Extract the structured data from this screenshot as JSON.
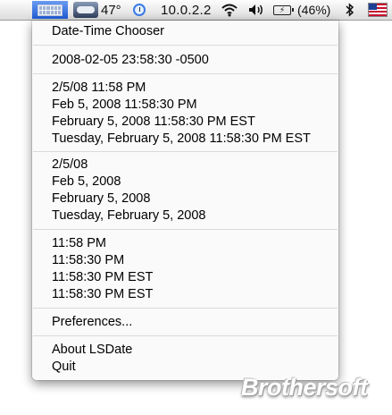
{
  "menubar": {
    "temperature": "47°",
    "ip_address": "10.0.2.2",
    "wifi_icon": "wifi-icon",
    "volume_icon": "volume-icon",
    "battery_icon_glyph": "⚡",
    "battery_percent": "(46%)",
    "bluetooth_icon": "bluetooth-icon",
    "input_flag": "us-flag-icon"
  },
  "menu": {
    "header": "Date-Time Chooser",
    "iso": "2008-02-05 23:58:30 -0500",
    "datetime_formats": [
      "2/5/08 11:58 PM",
      "Feb 5, 2008 11:58:30 PM",
      "February 5, 2008 11:58:30 PM EST",
      "Tuesday, February 5, 2008 11:58:30 PM EST"
    ],
    "date_formats": [
      "2/5/08",
      "Feb 5, 2008",
      "February 5, 2008",
      "Tuesday, February 5, 2008"
    ],
    "time_formats": [
      "11:58 PM",
      "11:58:30 PM",
      "11:58:30 PM EST",
      "11:58:30 PM EST"
    ],
    "preferences": "Preferences...",
    "about": "About LSDate",
    "quit": "Quit"
  },
  "watermark": "Brothersoft",
  "colors": {
    "menubar_highlight": "#2f6ae0",
    "menu_background": "#fafafa",
    "separator": "#dadada"
  }
}
